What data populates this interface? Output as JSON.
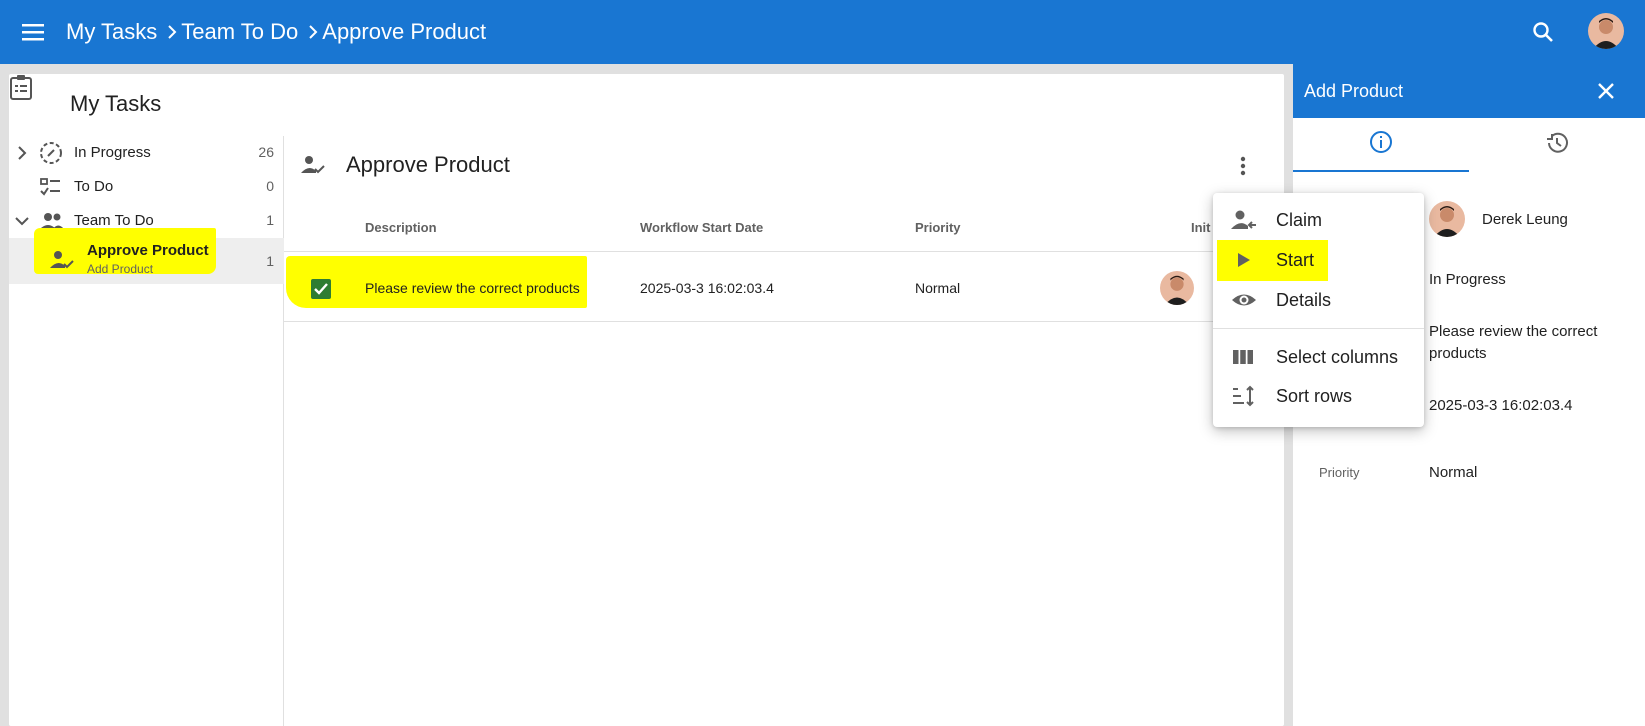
{
  "colors": {
    "primary": "#1976d2",
    "highlight": "#ffff00",
    "checkbox": "#2e7d32"
  },
  "topbar": {
    "menu_icon": "hamburger-icon",
    "breadcrumbs": [
      "My Tasks",
      "Team To Do",
      "Approve Product"
    ],
    "search_icon": "search-icon",
    "avatar_icon": "user-avatar"
  },
  "card": {
    "title": "My Tasks",
    "icon": "clipboard-icon"
  },
  "nav": {
    "items": [
      {
        "label": "In Progress",
        "count": "26",
        "icon": "in-progress-icon"
      },
      {
        "label": "To Do",
        "count": "0",
        "icon": "checklist-icon"
      },
      {
        "label": "Team To Do",
        "count": "1",
        "icon": "group-icon"
      },
      {
        "label": "Approve Product",
        "sublabel": "Add Product",
        "count": "1",
        "icon": "person-check-icon"
      }
    ]
  },
  "content": {
    "title": "Approve Product",
    "columns": [
      "Description",
      "Workflow Start Date",
      "Priority",
      "Init"
    ],
    "rows": [
      {
        "description": "Please review the correct products",
        "start_date": "2025-03-3 16:02:03.4",
        "priority": "Normal",
        "checked": true
      }
    ]
  },
  "context_menu": {
    "items": [
      {
        "label": "Claim",
        "icon": "person-claim-icon"
      },
      {
        "label": "Start",
        "icon": "play-icon"
      },
      {
        "label": "Details",
        "icon": "eye-icon"
      },
      {
        "label": "Select columns",
        "icon": "columns-icon"
      },
      {
        "label": "Sort rows",
        "icon": "sort-icon"
      }
    ]
  },
  "right_panel": {
    "title": "Add Product",
    "tabs": [
      "info-icon",
      "history-icon"
    ],
    "assignee": "Derek Leung",
    "status": "In Progress",
    "description": "Please review the correct products",
    "start_date": "2025-03-3 16:02:03.4",
    "priority_label": "Priority",
    "priority_value": "Normal"
  }
}
